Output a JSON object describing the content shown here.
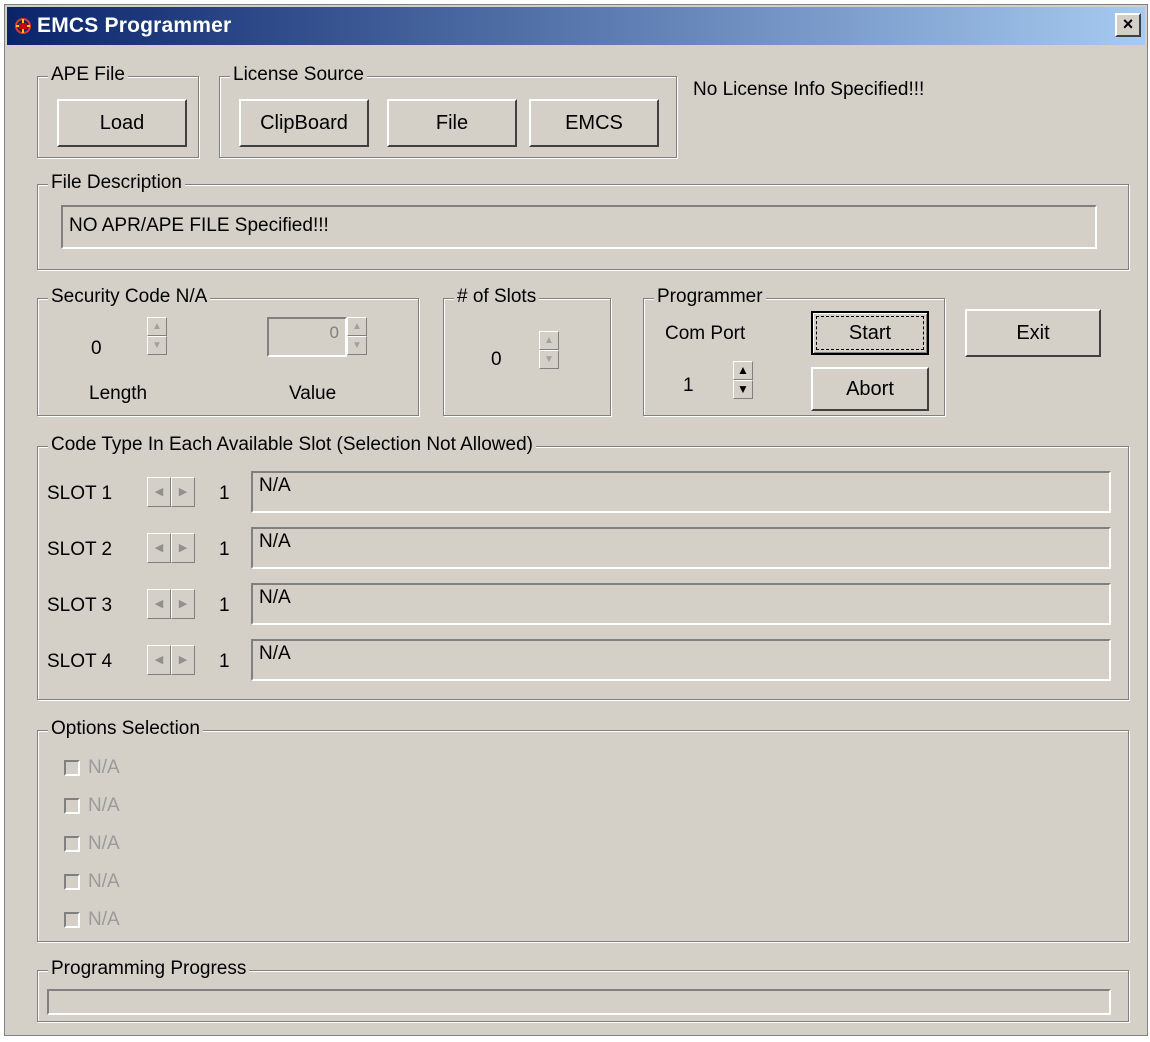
{
  "window": {
    "title": "EMCS Programmer",
    "close_glyph": "×",
    "title_icon": "app-logo-icon"
  },
  "ape_file": {
    "legend": "APE File",
    "load_label": "Load"
  },
  "license_source": {
    "legend": "License Source",
    "clipboard_label": "ClipBoard",
    "file_label": "File",
    "emcs_label": "EMCS"
  },
  "license_status": "No License Info Specified!!!",
  "file_description": {
    "legend": "File Description",
    "value": "NO APR/APE FILE Specified!!!"
  },
  "security_code": {
    "legend": "Security Code N/A",
    "length_value": "0",
    "length_label": "Length",
    "value_value": "0",
    "value_label": "Value"
  },
  "slots": {
    "legend": "# of Slots",
    "value": "0"
  },
  "programmer": {
    "legend": "Programmer",
    "com_port_label": "Com Port",
    "com_port_value": "1",
    "start_label": "Start",
    "abort_label": "Abort"
  },
  "exit_label": "Exit",
  "code_type": {
    "legend": "Code Type In Each Available Slot (Selection Not Allowed)",
    "rows": [
      {
        "label": "SLOT 1",
        "index": "1",
        "value": "N/A"
      },
      {
        "label": "SLOT 2",
        "index": "1",
        "value": "N/A"
      },
      {
        "label": "SLOT 3",
        "index": "1",
        "value": "N/A"
      },
      {
        "label": "SLOT 4",
        "index": "1",
        "value": "N/A"
      }
    ]
  },
  "options": {
    "legend": "Options Selection",
    "items": [
      {
        "label": "N/A",
        "checked": false
      },
      {
        "label": "N/A",
        "checked": false
      },
      {
        "label": "N/A",
        "checked": false
      },
      {
        "label": "N/A",
        "checked": false
      },
      {
        "label": "N/A",
        "checked": false
      }
    ]
  },
  "progress": {
    "legend": "Programming Progress",
    "fraction": 0
  }
}
